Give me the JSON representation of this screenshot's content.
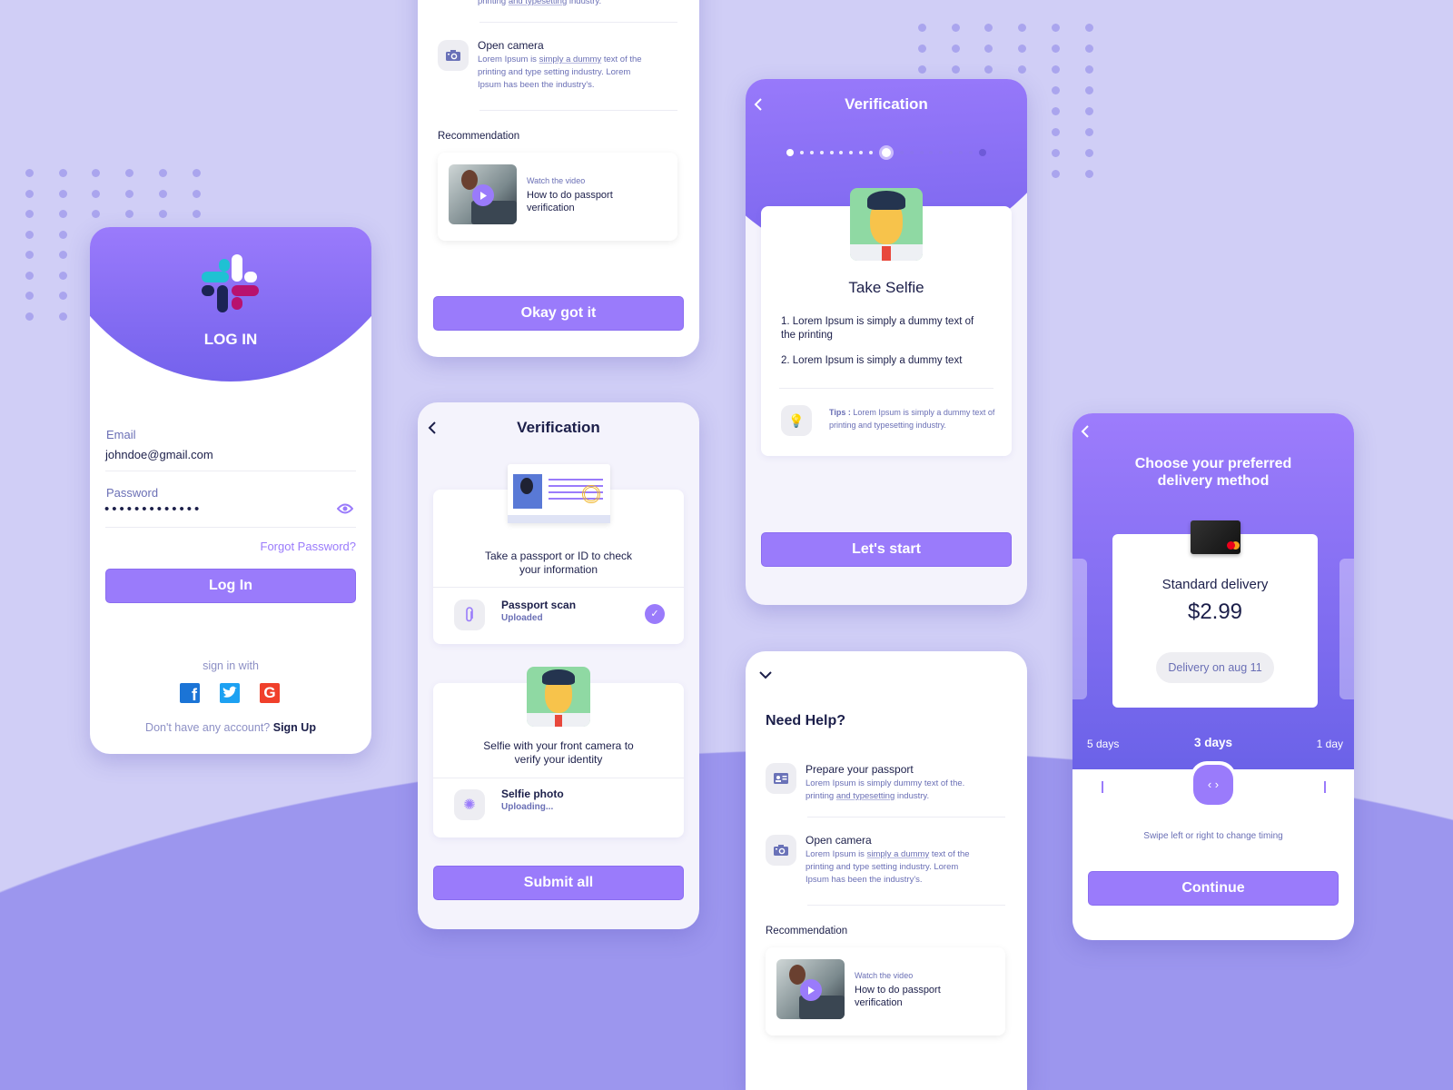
{
  "colors": {
    "accent": "#9a7bfb",
    "background": "#d0cef6",
    "text_dark": "#1c1f4a",
    "text_muted": "#6a6fb5"
  },
  "login": {
    "title": "LOG IN",
    "logo": "slack-logo",
    "email_label": "Email",
    "email_value": "johndoe@gmail.com",
    "password_label": "Password",
    "password_value": "•••••••••••••",
    "show_password_icon": "eye-icon",
    "forgot_password": "Forgot Password?",
    "login_button": "Log In",
    "sign_in_with": "sign in with",
    "social": [
      "facebook-icon",
      "twitter-icon",
      "google-icon"
    ],
    "no_account": "Don't have any account?",
    "sign_up": "Sign Up"
  },
  "help": {
    "title": "Need Help?",
    "items": [
      {
        "icon": "id-card-icon",
        "title": "Prepare your passport",
        "desc_1": "Lorem Ipsum is simply dummy text of the.",
        "desc_2": "printing ",
        "desc_link": "and typesetting",
        "desc_3": " industry."
      },
      {
        "icon": "camera-icon",
        "title": "Open camera",
        "desc_1": "Lorem Ipsum is ",
        "desc_link": "simply a dummy",
        "desc_2": " text of the printing and type setting industry. Lorem Ipsum has been the industry's."
      }
    ],
    "recommendation_label": "Recommendation",
    "video": {
      "kicker": "Watch the video",
      "title": "How to do passport verification"
    },
    "okay_button": "Okay got it"
  },
  "verification": {
    "title": "Verification",
    "passport": {
      "caption": "Take a passport or ID to check your information",
      "item_title": "Passport scan",
      "item_status": "Uploaded",
      "done": true
    },
    "selfie": {
      "caption": "Selfie with your front camera to verify your identity",
      "item_title": "Selfie photo",
      "item_status": "Uploading...",
      "done": false
    },
    "submit_button": "Submit all"
  },
  "selfie_step": {
    "title": "Verification",
    "progress": {
      "total_steps": 19,
      "current_step": 10
    },
    "heading": "Take Selfie",
    "steps": [
      "1.  Lorem Ipsum is simply a dummy text of the printing",
      "2.  Lorem Ipsum is simply a dummy text"
    ],
    "tips_label": "Tips :",
    "tips_text": " Lorem Ipsum is simply a dummy text of printing and typesetting industry.",
    "start_button": "Let's start"
  },
  "delivery": {
    "title": "Choose your preferred delivery method",
    "option_title": "Standard delivery",
    "price": "$2.99",
    "date_pill": "Delivery on aug 11",
    "timings": [
      "5 days",
      "3 days",
      "1 day"
    ],
    "selected_timing": "3 days",
    "hint": "Swipe left or right to change timing",
    "continue_button": "Continue"
  }
}
